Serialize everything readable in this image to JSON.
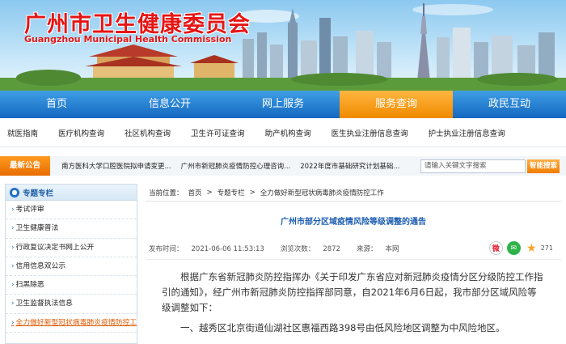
{
  "site": {
    "title": "广州市卫生健康委员会",
    "subtitle": "Guangzhou Municipal Health Commission"
  },
  "nav": {
    "items": [
      {
        "label": "首页"
      },
      {
        "label": "信息公开"
      },
      {
        "label": "网上服务"
      },
      {
        "label": "服务查询"
      },
      {
        "label": "政民互动"
      }
    ],
    "active_index": 3,
    "active_color": "#f39200"
  },
  "subnav": {
    "items": [
      {
        "label": "就医指南"
      },
      {
        "label": "医疗机构查询"
      },
      {
        "label": "社区机构查询"
      },
      {
        "label": "卫生许可证查询"
      },
      {
        "label": "助产机构查询"
      },
      {
        "label": "医生执业注册信息查询"
      },
      {
        "label": "护士执业注册信息查询"
      }
    ]
  },
  "notice": {
    "label": "最新公告",
    "items": [
      {
        "text": "南方医科大学口腔医院拟申请变更..."
      },
      {
        "text": "广州市新冠肺炎疫情防控心理咨询..."
      },
      {
        "text": "2022年度市基础研究计划基础..."
      }
    ],
    "search_placeholder": "请输入关键文字搜索",
    "search_button": "智能搜索"
  },
  "sidebar": {
    "title": "专题专栏",
    "items": [
      {
        "label": "考试评审"
      },
      {
        "label": "卫生健康普法"
      },
      {
        "label": "行政复议决定书网上公开"
      },
      {
        "label": "信用信息双公示"
      },
      {
        "label": "扫黑除恶"
      },
      {
        "label": "卫生监督执法信息"
      },
      {
        "label": "全力做好新型冠状病毒肺炎疫情防控工作"
      }
    ],
    "active_index": 6
  },
  "breadcrumb": {
    "prefix": "当前位置：",
    "items": [
      {
        "label": "首页"
      },
      {
        "label": "专题专栏"
      },
      {
        "label": "全力做好新型冠状病毒肺炎疫情防控工作"
      }
    ],
    "separator": ">"
  },
  "article": {
    "title": "广州市部分区域疫情风险等级调整的通告",
    "publish_label": "发布时间：",
    "publish_time": "2021-06-06 11:53:13",
    "views_label": "浏览次数：",
    "views": "2872",
    "source_label": "来源：",
    "source": "本网",
    "share_count": "271",
    "paragraphs": [
      "根据广东省新冠肺炎防控指挥办《关于印发广东省应对新冠肺炎疫情分区分级防控工作指引的通知》，经广州市新冠肺炎防控指挥部同意，自2021年6月6日起，我市部分区域风险等级调整如下：",
      "一、越秀区北京街道仙湖社区惠福西路398号由低风险地区调整为中风险地区。"
    ]
  },
  "colors": {
    "brand_red": "#e51515",
    "nav_blue": "#1a73c8",
    "link_blue": "#1a5cb0",
    "highlight_orange": "#e05a00"
  }
}
